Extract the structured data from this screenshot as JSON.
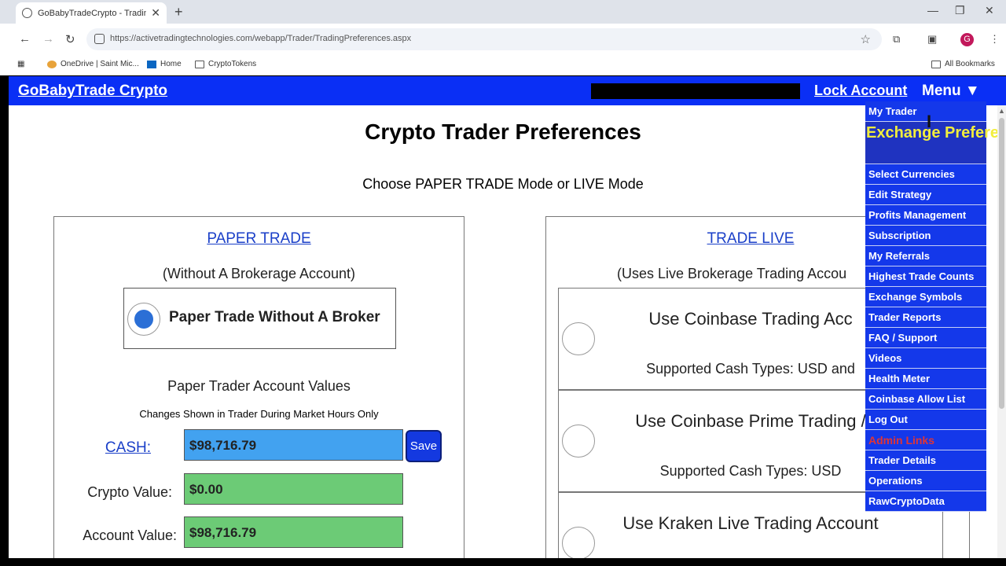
{
  "browser": {
    "tab_title": "GoBabyTradeCrypto - Trading P",
    "tab_close": "✕",
    "new_tab": "+",
    "url": "https://activetradingtechnologies.com/webapp/Trader/TradingPreferences.aspx",
    "profile_initial": "G",
    "bookmarks": [
      "OneDrive | Saint Mic...",
      "Home",
      "CryptoTokens"
    ],
    "all_bookmarks": "All Bookmarks"
  },
  "header": {
    "brand": "GoBabyTrade Crypto",
    "lock_account": "Lock Account",
    "menu": "Menu ▼",
    "accent_color": "#0a2ff5"
  },
  "main": {
    "title": "Crypto Trader Preferences",
    "subtitle": "Choose PAPER TRADE Mode or LIVE Mode"
  },
  "paper": {
    "link": "PAPER TRADE",
    "note": "(Without A Brokerage Account)",
    "option_label": "Paper Trade Without A Broker",
    "option_selected": true,
    "values_title": "Paper Trader Account Values",
    "values_note": "Changes Shown in Trader During Market Hours Only",
    "cash_label": "CASH:",
    "cash_value": "$98,716.79",
    "save": "Save",
    "crypto_label": "Crypto Value:",
    "crypto_value": "$0.00",
    "account_label": "Account Value:",
    "account_value": "$98,716.79"
  },
  "live": {
    "link": "TRADE LIVE",
    "note": "(Uses Live Brokerage Trading Accou",
    "options": [
      {
        "title": "Use Coinbase Trading Acc",
        "sub": "Supported Cash Types: USD and"
      },
      {
        "title": "Use Coinbase Prime Trading /",
        "sub": "Supported Cash Types: USD"
      },
      {
        "title": "Use Kraken Live Trading Account",
        "sub": ""
      }
    ]
  },
  "dropdown": {
    "items": [
      "My Trader",
      "Exchange Preferences",
      "Select Currencies",
      "Edit Strategy",
      "Profits Management",
      "Subscription",
      "My Referrals",
      "Highest Trade Counts",
      "Exchange Symbols",
      "Trader Reports",
      "FAQ / Support",
      "Videos",
      "Health Meter",
      "Coinbase Allow List",
      "Log Out",
      "Admin Links",
      "Trader Details",
      "Operations",
      "RawCryptoData"
    ]
  }
}
